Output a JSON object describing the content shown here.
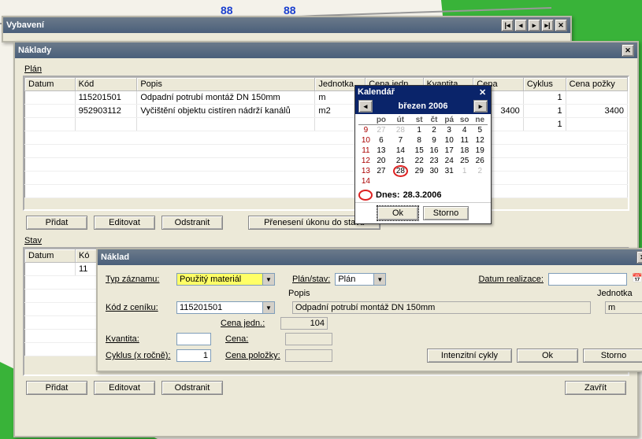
{
  "windows": {
    "vybaveni": {
      "title": "Vybavení"
    },
    "naklady": {
      "title": "Náklady",
      "plan_label": "Plán",
      "stav_label": "Stav",
      "columns": {
        "datum": "Datum",
        "kod": "Kód",
        "popis": "Popis",
        "jednotka": "Jednotka",
        "cena_jedn": "Cena jedn.",
        "kvantita": "Kvantita",
        "cena": "Cena",
        "cyklus": "Cyklus",
        "cena_pozky": "Cena požky"
      },
      "rows": [
        {
          "datum": "",
          "kod": "115201501",
          "popis": "Odpadní potrubí montáž DN 150mm",
          "jednotka": "m",
          "cena_jedn": "",
          "kvantita": "",
          "cena": "",
          "cyklus": "1",
          "cena_pozky": ""
        },
        {
          "datum": "",
          "kod": "952903112",
          "popis": "Vyčištění objektu cistíren nádrží kanálů",
          "jednotka": "m2",
          "cena_jedn": "",
          "kvantita": "",
          "cena": "3400",
          "cyklus": "1",
          "cena_pozky": "3400"
        }
      ],
      "stav_rows": [
        {
          "datum": "",
          "kod": "11"
        }
      ],
      "buttons": {
        "pridat": "Přidat",
        "editovat": "Editovat",
        "odstranit": "Odstranit",
        "prenest": "Přenesení úkonu do stavu",
        "zavrit": "Zavřít"
      }
    },
    "kalendar": {
      "title": "Kalendář",
      "month_label": "březen 2006",
      "weekday_headers": [
        "po",
        "út",
        "st",
        "čt",
        "pá",
        "so",
        "ne"
      ],
      "week_numbers": [
        "9",
        "10",
        "11",
        "12",
        "13",
        "14"
      ],
      "days": [
        [
          "27",
          "28",
          "1",
          "2",
          "3",
          "4",
          "5"
        ],
        [
          "6",
          "7",
          "8",
          "9",
          "10",
          "11",
          "12"
        ],
        [
          "13",
          "14",
          "15",
          "16",
          "17",
          "18",
          "19"
        ],
        [
          "20",
          "21",
          "22",
          "23",
          "24",
          "25",
          "26"
        ],
        [
          "27",
          "28",
          "29",
          "30",
          "31",
          "1",
          "2"
        ],
        [
          "",
          "",
          "",
          "",
          "",
          "",
          ""
        ]
      ],
      "dim_first_row_count": 2,
      "dim_last_real_row_from": 5,
      "today_row": 4,
      "today_col": 1,
      "today_label": "Dnes:",
      "today_value": "28.3.2006",
      "ok": "Ok",
      "storno": "Storno"
    },
    "naklad": {
      "title": "Náklad",
      "labels": {
        "typ_zaznamu": "Typ záznamu:",
        "plan_stav": "Plán/stav:",
        "datum_realizace": "Datum realizace:",
        "kod_z_ceniku": "Kód z ceníku:",
        "popis": "Popis",
        "jednotka": "Jednotka",
        "cyklus": "Cyklus (x ročně):",
        "cena_jedn": "Cena jedn.:",
        "kvantita": "Kvantita:",
        "cena": "Cena:",
        "cena_polozky": "Cena položky:"
      },
      "values": {
        "typ_zaznamu": "Použitý materiál",
        "plan_stav": "Plán",
        "datum_realizace": "",
        "kod_z_ceniku": "115201501",
        "popis": "Odpadní potrubí montáž DN 150mm",
        "jednotka": "m",
        "cena_jedn": "104",
        "kvantita": "",
        "cena": "",
        "cena_polozky": "",
        "cyklus": "1"
      },
      "buttons": {
        "intenzitni": "Intenzitní cykly",
        "ok": "Ok",
        "storno": "Storno"
      }
    }
  }
}
